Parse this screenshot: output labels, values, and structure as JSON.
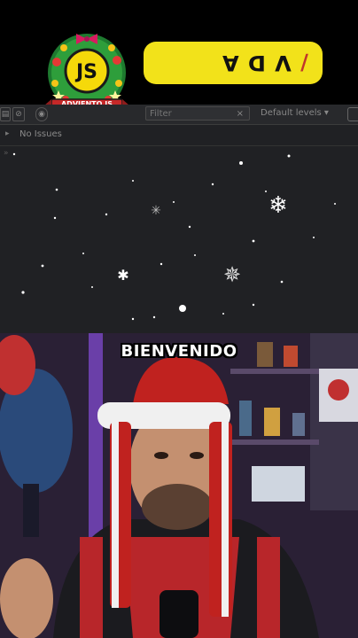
{
  "badge": {
    "logo_text": "JS",
    "ribbon_text": "ADVIENTO.JS",
    "icon": "advent-wreath-icon"
  },
  "banner": {
    "pill_slash": "/",
    "pill_text": "V D A",
    "pill_color": "#f2e21a"
  },
  "devtools": {
    "filter_placeholder": "Filter",
    "filter_clear": "×",
    "levels_label": "Default levels ▾",
    "status": "No Issues",
    "settings_icon": "gear-icon"
  },
  "video": {
    "caption": "BIENVENIDO"
  }
}
